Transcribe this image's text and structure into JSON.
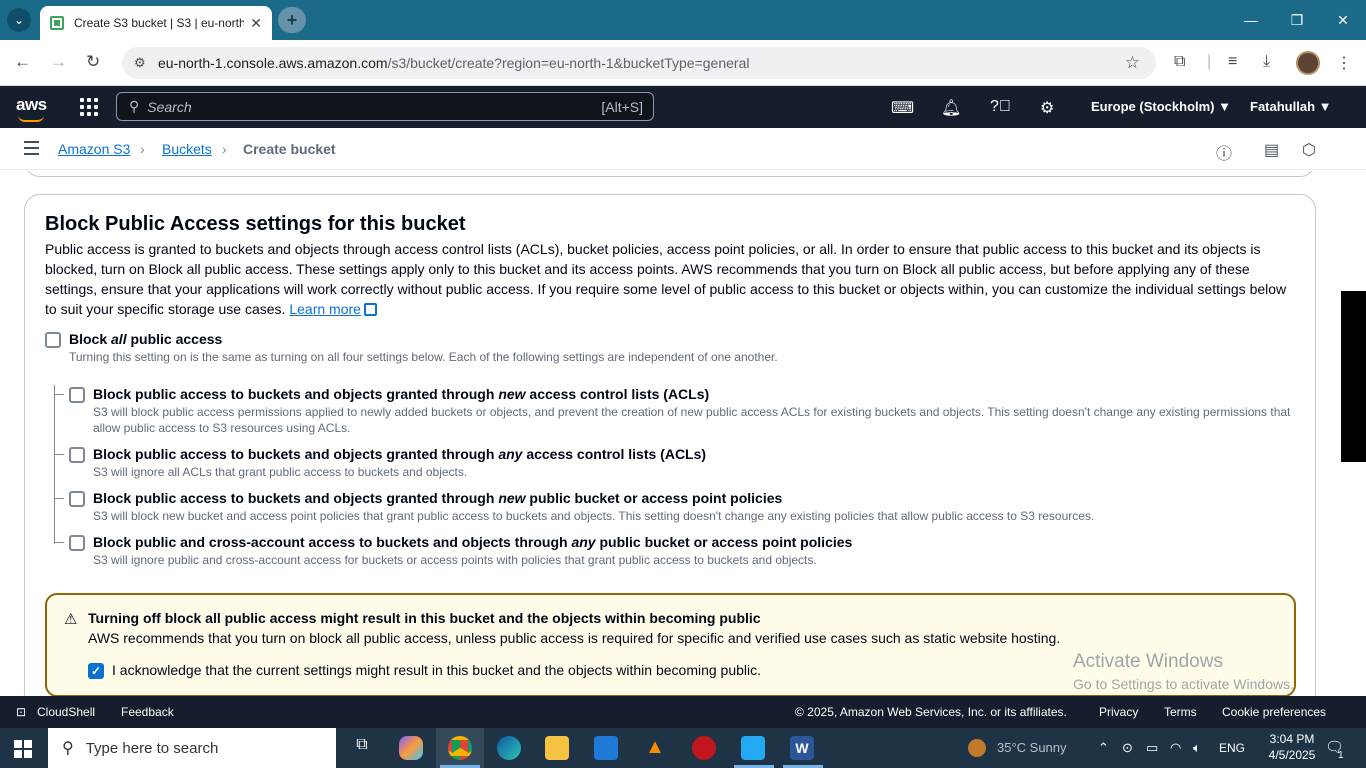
{
  "browser": {
    "tab_title": "Create S3 bucket | S3 | eu-north-1",
    "tab_close": "✕",
    "new_tab": "+",
    "url_host": "eu-north-1.console.aws.amazon.com",
    "url_path": "/s3/bucket/create?region=eu-north-1&bucketType=general",
    "window_controls": {
      "minimize": "—",
      "restore": "❐",
      "close": "✕"
    }
  },
  "aws_nav": {
    "logo": "aws",
    "search_placeholder": "Search",
    "search_shortcut": "[Alt+S]",
    "region": "Europe (Stockholm) ▼",
    "user": "Fatahullah ▼"
  },
  "breadcrumb": {
    "items": [
      "Amazon S3",
      "Buckets",
      "Create bucket"
    ],
    "separator": "›"
  },
  "block_public_access": {
    "title": "Block Public Access settings for this bucket",
    "description": "Public access is granted to buckets and objects through access control lists (ACLs), bucket policies, access point policies, or all. In order to ensure that public access to this bucket and its objects is blocked, turn on Block all public access. These settings apply only to this bucket and its access points. AWS recommends that you turn on Block all public access, but before applying any of these settings, ensure that your applications will work correctly without public access. If you require some level of public access to this bucket or objects within, you can customize the individual settings below to suit your specific storage use cases.",
    "learn_more": "Learn more",
    "block_all": {
      "label_pre": "Block ",
      "label_em": "all",
      "label_post": " public access",
      "description": "Turning this setting on is the same as turning on all four settings below. Each of the following settings are independent of one another.",
      "checked": false
    },
    "options": [
      {
        "label_pre": "Block public access to buckets and objects granted through ",
        "label_em": "new",
        "label_post": " access control lists (ACLs)",
        "description": "S3 will block public access permissions applied to newly added buckets or objects, and prevent the creation of new public access ACLs for existing buckets and objects. This setting doesn't change any existing permissions that allow public access to S3 resources using ACLs.",
        "checked": false
      },
      {
        "label_pre": "Block public access to buckets and objects granted through ",
        "label_em": "any",
        "label_post": " access control lists (ACLs)",
        "description": "S3 will ignore all ACLs that grant public access to buckets and objects.",
        "checked": false
      },
      {
        "label_pre": "Block public access to buckets and objects granted through ",
        "label_em": "new",
        "label_post": " public bucket or access point policies",
        "description": "S3 will block new bucket and access point policies that grant public access to buckets and objects. This setting doesn't change any existing policies that allow public access to S3 resources.",
        "checked": false
      },
      {
        "label_pre": "Block public and cross-account access to buckets and objects through ",
        "label_em": "any",
        "label_post": " public bucket or access point policies",
        "description": "S3 will ignore public and cross-account access for buckets or access points with policies that grant public access to buckets and objects.",
        "checked": false
      }
    ],
    "warning": {
      "title": "Turning off block all public access might result in this bucket and the objects within becoming public",
      "text": "AWS recommends that you turn on block all public access, unless public access is required for specific and verified use cases such as static website hosting.",
      "acknowledge": "I acknowledge that the current settings might result in this bucket and the objects within becoming public.",
      "acknowledged": true
    }
  },
  "watermark": {
    "line1": "Activate Windows",
    "line2": "Go to Settings to activate Windows."
  },
  "footer": {
    "cloudshell": "CloudShell",
    "feedback": "Feedback",
    "copyright": "© 2025, Amazon Web Services, Inc. or its affiliates.",
    "privacy": "Privacy",
    "terms": "Terms",
    "cookies": "Cookie preferences"
  },
  "taskbar": {
    "search_placeholder": "Type here to search",
    "weather": "35°C  Sunny",
    "language": "ENG",
    "time": "3:04 PM",
    "date": "4/5/2025",
    "notification_count": "1"
  },
  "colors": {
    "aws_nav_bg": "#161e2d",
    "link": "#0972d3",
    "warning_border": "#8d6605",
    "warning_bg": "#fffce9",
    "tabbar_bg": "#1c6a8a"
  }
}
